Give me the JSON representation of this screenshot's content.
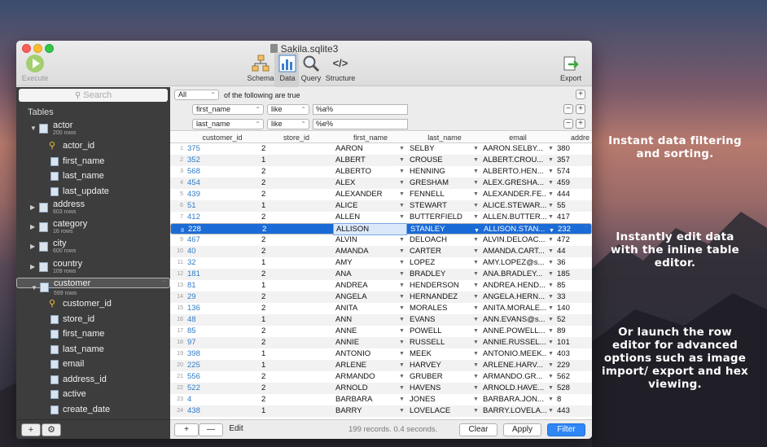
{
  "window": {
    "title": "Sakila.sqlite3"
  },
  "toolbar": {
    "execute": "Execute",
    "schema": "Schema",
    "data": "Data",
    "query": "Query",
    "structure": "Structure",
    "export": "Export"
  },
  "sidebar": {
    "search_placeholder": "Search",
    "tables_header": "Tables",
    "tables": [
      {
        "name": "actor",
        "rows": "200 rows",
        "expanded": true,
        "columns": [
          {
            "name": "actor_id",
            "key": true
          },
          {
            "name": "first_name"
          },
          {
            "name": "last_name"
          },
          {
            "name": "last_update"
          }
        ]
      },
      {
        "name": "address",
        "rows": "603 rows"
      },
      {
        "name": "category",
        "rows": "16 rows"
      },
      {
        "name": "city",
        "rows": "600 rows"
      },
      {
        "name": "country",
        "rows": "109 rows"
      },
      {
        "name": "customer",
        "rows": "599 rows",
        "expanded": true,
        "selected": true,
        "columns": [
          {
            "name": "customer_id",
            "key": true
          },
          {
            "name": "store_id"
          },
          {
            "name": "first_name"
          },
          {
            "name": "last_name"
          },
          {
            "name": "email"
          },
          {
            "name": "address_id"
          },
          {
            "name": "active"
          },
          {
            "name": "create_date"
          }
        ]
      }
    ]
  },
  "filters": {
    "match_select": "All",
    "match_label": "of the following are true",
    "rules": [
      {
        "column": "first_name",
        "operator": "like",
        "value": "%a%"
      },
      {
        "column": "last_name",
        "operator": "like",
        "value": "%e%"
      }
    ]
  },
  "grid": {
    "columns": [
      "customer_id",
      "store_id",
      "first_name",
      "last_name",
      "email",
      "addre"
    ],
    "selected_row": 8,
    "rows": [
      {
        "n": "1",
        "id": "375",
        "store": "2",
        "first": "AARON",
        "last": "SELBY",
        "email": "AARON.SELBY...",
        "addr": "380"
      },
      {
        "n": "2",
        "id": "352",
        "store": "1",
        "first": "ALBERT",
        "last": "CROUSE",
        "email": "ALBERT.CROU...",
        "addr": "357"
      },
      {
        "n": "3",
        "id": "568",
        "store": "2",
        "first": "ALBERTO",
        "last": "HENNING",
        "email": "ALBERTO.HEN...",
        "addr": "574"
      },
      {
        "n": "4",
        "id": "454",
        "store": "2",
        "first": "ALEX",
        "last": "GRESHAM",
        "email": "ALEX.GRESHA...",
        "addr": "459"
      },
      {
        "n": "5",
        "id": "439",
        "store": "2",
        "first": "ALEXANDER",
        "last": "FENNELL",
        "email": "ALEXANDER.FE...",
        "addr": "444"
      },
      {
        "n": "6",
        "id": "51",
        "store": "1",
        "first": "ALICE",
        "last": "STEWART",
        "email": "ALICE.STEWAR...",
        "addr": "55"
      },
      {
        "n": "7",
        "id": "412",
        "store": "2",
        "first": "ALLEN",
        "last": "BUTTERFIELD",
        "email": "ALLEN.BUTTER...",
        "addr": "417"
      },
      {
        "n": "8",
        "id": "228",
        "store": "2",
        "first": "ALLISON",
        "last": "STANLEY",
        "email": "ALLISON.STAN...",
        "addr": "232"
      },
      {
        "n": "9",
        "id": "467",
        "store": "2",
        "first": "ALVIN",
        "last": "DELOACH",
        "email": "ALVIN.DELOAC...",
        "addr": "472"
      },
      {
        "n": "10",
        "id": "40",
        "store": "2",
        "first": "AMANDA",
        "last": "CARTER",
        "email": "AMANDA.CART...",
        "addr": "44"
      },
      {
        "n": "11",
        "id": "32",
        "store": "1",
        "first": "AMY",
        "last": "LOPEZ",
        "email": "AMY.LOPEZ@s...",
        "addr": "36"
      },
      {
        "n": "12",
        "id": "181",
        "store": "2",
        "first": "ANA",
        "last": "BRADLEY",
        "email": "ANA.BRADLEY...",
        "addr": "185"
      },
      {
        "n": "13",
        "id": "81",
        "store": "1",
        "first": "ANDREA",
        "last": "HENDERSON",
        "email": "ANDREA.HEND...",
        "addr": "85"
      },
      {
        "n": "14",
        "id": "29",
        "store": "2",
        "first": "ANGELA",
        "last": "HERNANDEZ",
        "email": "ANGELA.HERN...",
        "addr": "33"
      },
      {
        "n": "15",
        "id": "136",
        "store": "2",
        "first": "ANITA",
        "last": "MORALES",
        "email": "ANITA.MORALE...",
        "addr": "140"
      },
      {
        "n": "16",
        "id": "48",
        "store": "1",
        "first": "ANN",
        "last": "EVANS",
        "email": "ANN.EVANS@s...",
        "addr": "52"
      },
      {
        "n": "17",
        "id": "85",
        "store": "2",
        "first": "ANNE",
        "last": "POWELL",
        "email": "ANNE.POWELL...",
        "addr": "89"
      },
      {
        "n": "18",
        "id": "97",
        "store": "2",
        "first": "ANNIE",
        "last": "RUSSELL",
        "email": "ANNIE.RUSSEL...",
        "addr": "101"
      },
      {
        "n": "19",
        "id": "398",
        "store": "1",
        "first": "ANTONIO",
        "last": "MEEK",
        "email": "ANTONIO.MEEK...",
        "addr": "403"
      },
      {
        "n": "20",
        "id": "225",
        "store": "1",
        "first": "ARLENE",
        "last": "HARVEY",
        "email": "ARLENE.HARV...",
        "addr": "229"
      },
      {
        "n": "21",
        "id": "556",
        "store": "2",
        "first": "ARMANDO",
        "last": "GRUBER",
        "email": "ARMANDO.GR...",
        "addr": "562"
      },
      {
        "n": "22",
        "id": "522",
        "store": "2",
        "first": "ARNOLD",
        "last": "HAVENS",
        "email": "ARNOLD.HAVE...",
        "addr": "528"
      },
      {
        "n": "23",
        "id": "4",
        "store": "2",
        "first": "BARBARA",
        "last": "JONES",
        "email": "BARBARA.JON...",
        "addr": "8"
      },
      {
        "n": "24",
        "id": "438",
        "store": "1",
        "first": "BARRY",
        "last": "LOVELACE",
        "email": "BARRY.LOVELA...",
        "addr": "443"
      }
    ]
  },
  "footer": {
    "add": "+",
    "remove": "—",
    "edit": "Edit",
    "status": "199 records. 0.4 seconds.",
    "clear": "Clear",
    "apply": "Apply",
    "filter": "Filter"
  },
  "captions": [
    "Instant data filtering and sorting.",
    "Instantly edit data with the inline table editor.",
    "Or launch the row editor for advanced options such as image import/ export and hex viewing."
  ]
}
